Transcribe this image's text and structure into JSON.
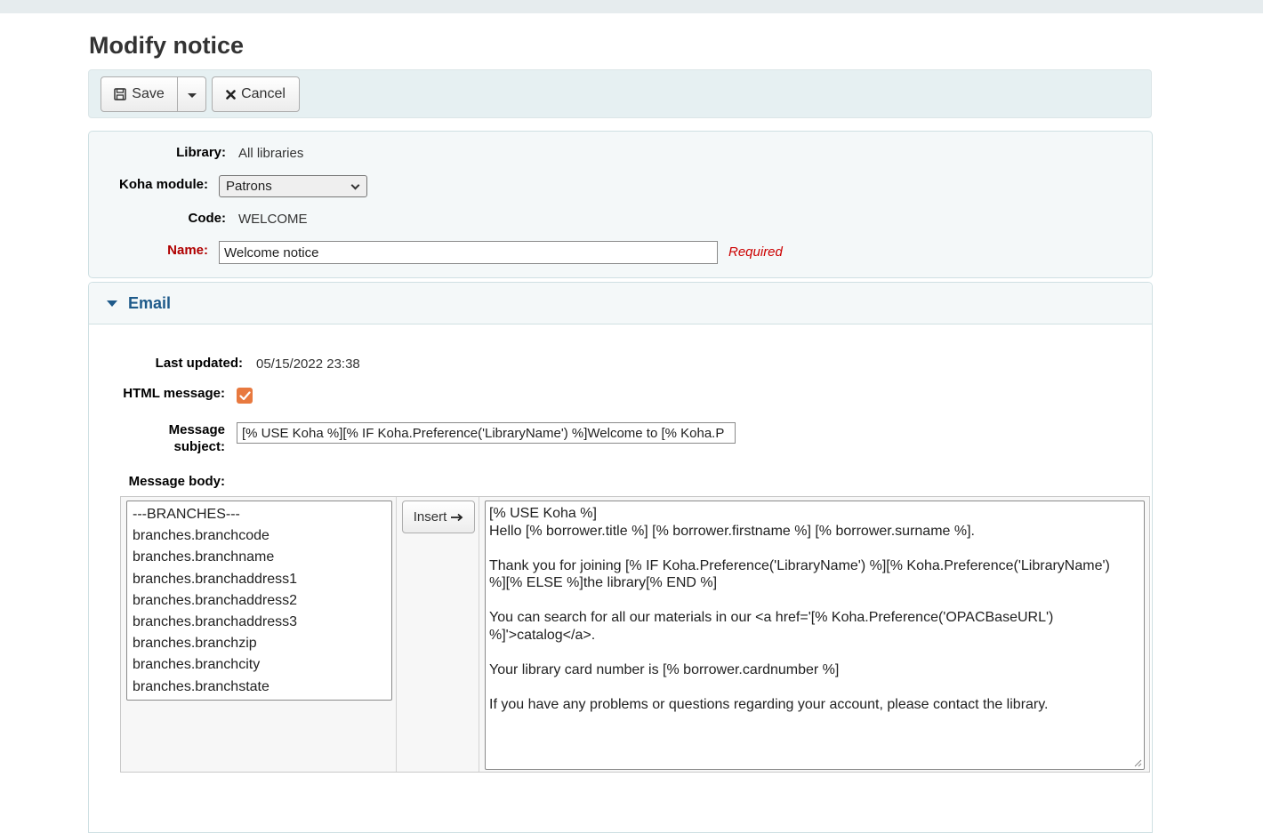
{
  "page": {
    "title": "Modify notice"
  },
  "toolbar": {
    "save_label": "Save",
    "cancel_label": "Cancel"
  },
  "details": {
    "library_label": "Library:",
    "library_value": "All libraries",
    "module_label": "Koha module:",
    "module_value": "Patrons",
    "code_label": "Code:",
    "code_value": "WELCOME",
    "name_label": "Name:",
    "name_value": "Welcome notice",
    "required_text": "Required"
  },
  "email": {
    "section_title": "Email",
    "last_updated_label": "Last updated:",
    "last_updated_value": "05/15/2022 23:38",
    "html_message_label": "HTML message:",
    "html_message_checked": true,
    "subject_label_1": "Message",
    "subject_label_2": "subject:",
    "subject_value": "[% USE Koha %][% IF Koha.Preference('LibraryName') %]Welcome to [% Koha.P",
    "body_label": "Message body:",
    "insert_label": "Insert",
    "fields": [
      "---BRANCHES---",
      "branches.branchcode",
      "branches.branchname",
      "branches.branchaddress1",
      "branches.branchaddress2",
      "branches.branchaddress3",
      "branches.branchzip",
      "branches.branchcity",
      "branches.branchstate"
    ],
    "body_lines": [
      "[% USE Koha %]",
      "Hello [% borrower.title %] [% borrower.firstname %] [% borrower.surname %].",
      "",
      "Thank you for joining [% IF Koha.Preference('LibraryName') %][% Koha.Preference('LibraryName')",
      "%][% ELSE %]the library[% END %]",
      "",
      "You can search for all our materials in our <a href='[% Koha.Preference('OPACBaseURL')",
      "%]'>catalog</a>.",
      "",
      "Your library card number is [% borrower.cardnumber %]",
      "",
      "If you have any problems or questions regarding your account, please contact the library."
    ]
  },
  "colors": {
    "accent": "#1e5a8a",
    "required": "#cc0000",
    "checkbox": "#e8793f",
    "panel_bg": "#f4f8f9"
  }
}
